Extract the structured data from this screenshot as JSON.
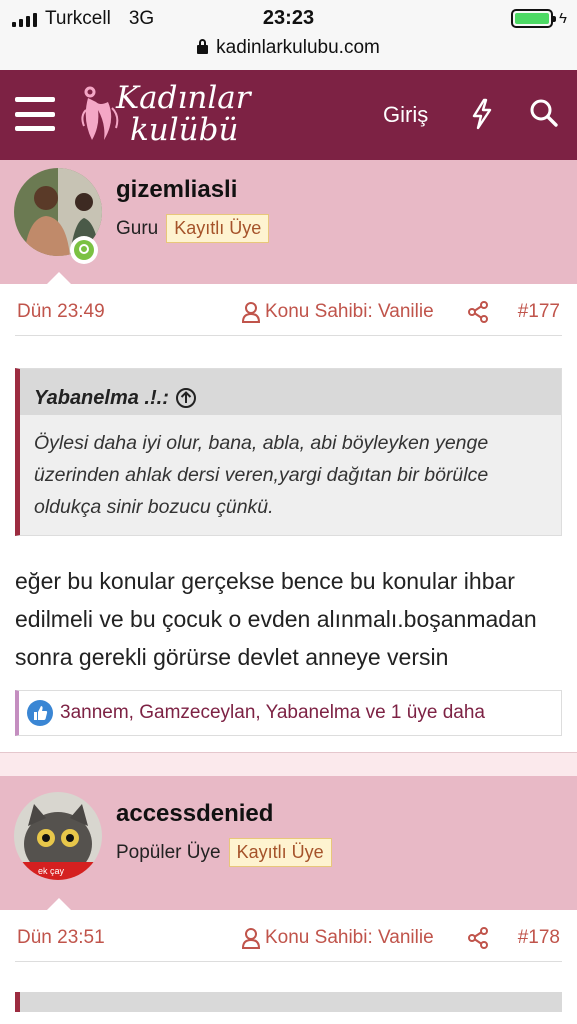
{
  "status_bar": {
    "carrier": "Turkcell",
    "network": "3G",
    "time": "23:23",
    "url": "kadinlarkulubu.com"
  },
  "header": {
    "logo_line1": "Kadınlar",
    "logo_line2": "kulübü",
    "login_label": "Giriş",
    "brand_color": "#7d2244"
  },
  "posts": [
    {
      "username": "gizemliasli",
      "user_title": "Guru",
      "badge": "Kayıtlı Üye",
      "date": "Dün 23:49",
      "thread_owner": "Konu Sahibi: Vanilie",
      "post_number": "#177",
      "quote": {
        "author": "Yabanelma .!.:",
        "text": "Öylesi daha iyi olur, bana, abla, abi böyleyken yenge üzerinden ahlak dersi veren,yargi dağıtan bir börülce oldukça sinir bozucu çünkü."
      },
      "body": "eğer bu konular gerçekse bence bu konular ihbar edilmeli ve bu çocuk o evden alınmalı.boşanmadan sonra gerekli görürse devlet anneye versin",
      "reactions": "3annem, Gamzeceylan, Yabanelma ve 1 üye daha"
    },
    {
      "username": "accessdenied",
      "user_title": "Popüler Üye",
      "badge": "Kayıtlı Üye",
      "date": "Dün 23:51",
      "thread_owner": "Konu Sahibi: Vanilie",
      "post_number": "#178",
      "avatar_caption": "ek çay"
    }
  ]
}
